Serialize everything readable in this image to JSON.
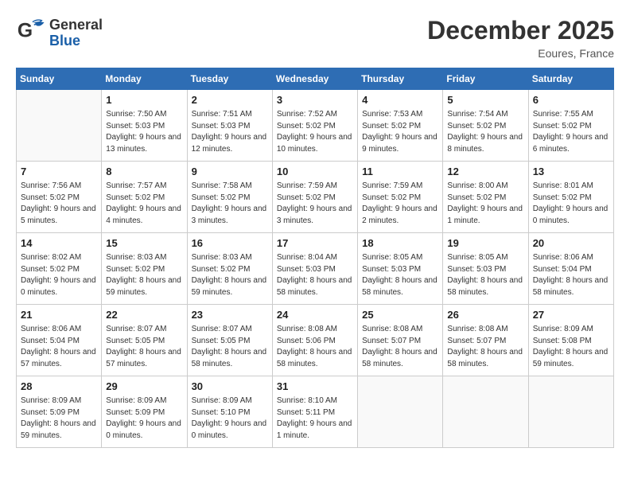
{
  "header": {
    "logo_general": "General",
    "logo_blue": "Blue",
    "month": "December 2025",
    "location": "Eoures, France"
  },
  "days_of_week": [
    "Sunday",
    "Monday",
    "Tuesday",
    "Wednesday",
    "Thursday",
    "Friday",
    "Saturday"
  ],
  "weeks": [
    [
      {
        "num": "",
        "empty": true
      },
      {
        "num": "1",
        "sunrise": "Sunrise: 7:50 AM",
        "sunset": "Sunset: 5:03 PM",
        "daylight": "Daylight: 9 hours and 13 minutes."
      },
      {
        "num": "2",
        "sunrise": "Sunrise: 7:51 AM",
        "sunset": "Sunset: 5:03 PM",
        "daylight": "Daylight: 9 hours and 12 minutes."
      },
      {
        "num": "3",
        "sunrise": "Sunrise: 7:52 AM",
        "sunset": "Sunset: 5:02 PM",
        "daylight": "Daylight: 9 hours and 10 minutes."
      },
      {
        "num": "4",
        "sunrise": "Sunrise: 7:53 AM",
        "sunset": "Sunset: 5:02 PM",
        "daylight": "Daylight: 9 hours and 9 minutes."
      },
      {
        "num": "5",
        "sunrise": "Sunrise: 7:54 AM",
        "sunset": "Sunset: 5:02 PM",
        "daylight": "Daylight: 9 hours and 8 minutes."
      },
      {
        "num": "6",
        "sunrise": "Sunrise: 7:55 AM",
        "sunset": "Sunset: 5:02 PM",
        "daylight": "Daylight: 9 hours and 6 minutes."
      }
    ],
    [
      {
        "num": "7",
        "sunrise": "Sunrise: 7:56 AM",
        "sunset": "Sunset: 5:02 PM",
        "daylight": "Daylight: 9 hours and 5 minutes."
      },
      {
        "num": "8",
        "sunrise": "Sunrise: 7:57 AM",
        "sunset": "Sunset: 5:02 PM",
        "daylight": "Daylight: 9 hours and 4 minutes."
      },
      {
        "num": "9",
        "sunrise": "Sunrise: 7:58 AM",
        "sunset": "Sunset: 5:02 PM",
        "daylight": "Daylight: 9 hours and 3 minutes."
      },
      {
        "num": "10",
        "sunrise": "Sunrise: 7:59 AM",
        "sunset": "Sunset: 5:02 PM",
        "daylight": "Daylight: 9 hours and 3 minutes."
      },
      {
        "num": "11",
        "sunrise": "Sunrise: 7:59 AM",
        "sunset": "Sunset: 5:02 PM",
        "daylight": "Daylight: 9 hours and 2 minutes."
      },
      {
        "num": "12",
        "sunrise": "Sunrise: 8:00 AM",
        "sunset": "Sunset: 5:02 PM",
        "daylight": "Daylight: 9 hours and 1 minute."
      },
      {
        "num": "13",
        "sunrise": "Sunrise: 8:01 AM",
        "sunset": "Sunset: 5:02 PM",
        "daylight": "Daylight: 9 hours and 0 minutes."
      }
    ],
    [
      {
        "num": "14",
        "sunrise": "Sunrise: 8:02 AM",
        "sunset": "Sunset: 5:02 PM",
        "daylight": "Daylight: 9 hours and 0 minutes."
      },
      {
        "num": "15",
        "sunrise": "Sunrise: 8:03 AM",
        "sunset": "Sunset: 5:02 PM",
        "daylight": "Daylight: 8 hours and 59 minutes."
      },
      {
        "num": "16",
        "sunrise": "Sunrise: 8:03 AM",
        "sunset": "Sunset: 5:02 PM",
        "daylight": "Daylight: 8 hours and 59 minutes."
      },
      {
        "num": "17",
        "sunrise": "Sunrise: 8:04 AM",
        "sunset": "Sunset: 5:03 PM",
        "daylight": "Daylight: 8 hours and 58 minutes."
      },
      {
        "num": "18",
        "sunrise": "Sunrise: 8:05 AM",
        "sunset": "Sunset: 5:03 PM",
        "daylight": "Daylight: 8 hours and 58 minutes."
      },
      {
        "num": "19",
        "sunrise": "Sunrise: 8:05 AM",
        "sunset": "Sunset: 5:03 PM",
        "daylight": "Daylight: 8 hours and 58 minutes."
      },
      {
        "num": "20",
        "sunrise": "Sunrise: 8:06 AM",
        "sunset": "Sunset: 5:04 PM",
        "daylight": "Daylight: 8 hours and 58 minutes."
      }
    ],
    [
      {
        "num": "21",
        "sunrise": "Sunrise: 8:06 AM",
        "sunset": "Sunset: 5:04 PM",
        "daylight": "Daylight: 8 hours and 57 minutes."
      },
      {
        "num": "22",
        "sunrise": "Sunrise: 8:07 AM",
        "sunset": "Sunset: 5:05 PM",
        "daylight": "Daylight: 8 hours and 57 minutes."
      },
      {
        "num": "23",
        "sunrise": "Sunrise: 8:07 AM",
        "sunset": "Sunset: 5:05 PM",
        "daylight": "Daylight: 8 hours and 58 minutes."
      },
      {
        "num": "24",
        "sunrise": "Sunrise: 8:08 AM",
        "sunset": "Sunset: 5:06 PM",
        "daylight": "Daylight: 8 hours and 58 minutes."
      },
      {
        "num": "25",
        "sunrise": "Sunrise: 8:08 AM",
        "sunset": "Sunset: 5:07 PM",
        "daylight": "Daylight: 8 hours and 58 minutes."
      },
      {
        "num": "26",
        "sunrise": "Sunrise: 8:08 AM",
        "sunset": "Sunset: 5:07 PM",
        "daylight": "Daylight: 8 hours and 58 minutes."
      },
      {
        "num": "27",
        "sunrise": "Sunrise: 8:09 AM",
        "sunset": "Sunset: 5:08 PM",
        "daylight": "Daylight: 8 hours and 59 minutes."
      }
    ],
    [
      {
        "num": "28",
        "sunrise": "Sunrise: 8:09 AM",
        "sunset": "Sunset: 5:09 PM",
        "daylight": "Daylight: 8 hours and 59 minutes."
      },
      {
        "num": "29",
        "sunrise": "Sunrise: 8:09 AM",
        "sunset": "Sunset: 5:09 PM",
        "daylight": "Daylight: 9 hours and 0 minutes."
      },
      {
        "num": "30",
        "sunrise": "Sunrise: 8:09 AM",
        "sunset": "Sunset: 5:10 PM",
        "daylight": "Daylight: 9 hours and 0 minutes."
      },
      {
        "num": "31",
        "sunrise": "Sunrise: 8:10 AM",
        "sunset": "Sunset: 5:11 PM",
        "daylight": "Daylight: 9 hours and 1 minute."
      },
      {
        "num": "",
        "empty": true
      },
      {
        "num": "",
        "empty": true
      },
      {
        "num": "",
        "empty": true
      }
    ]
  ]
}
